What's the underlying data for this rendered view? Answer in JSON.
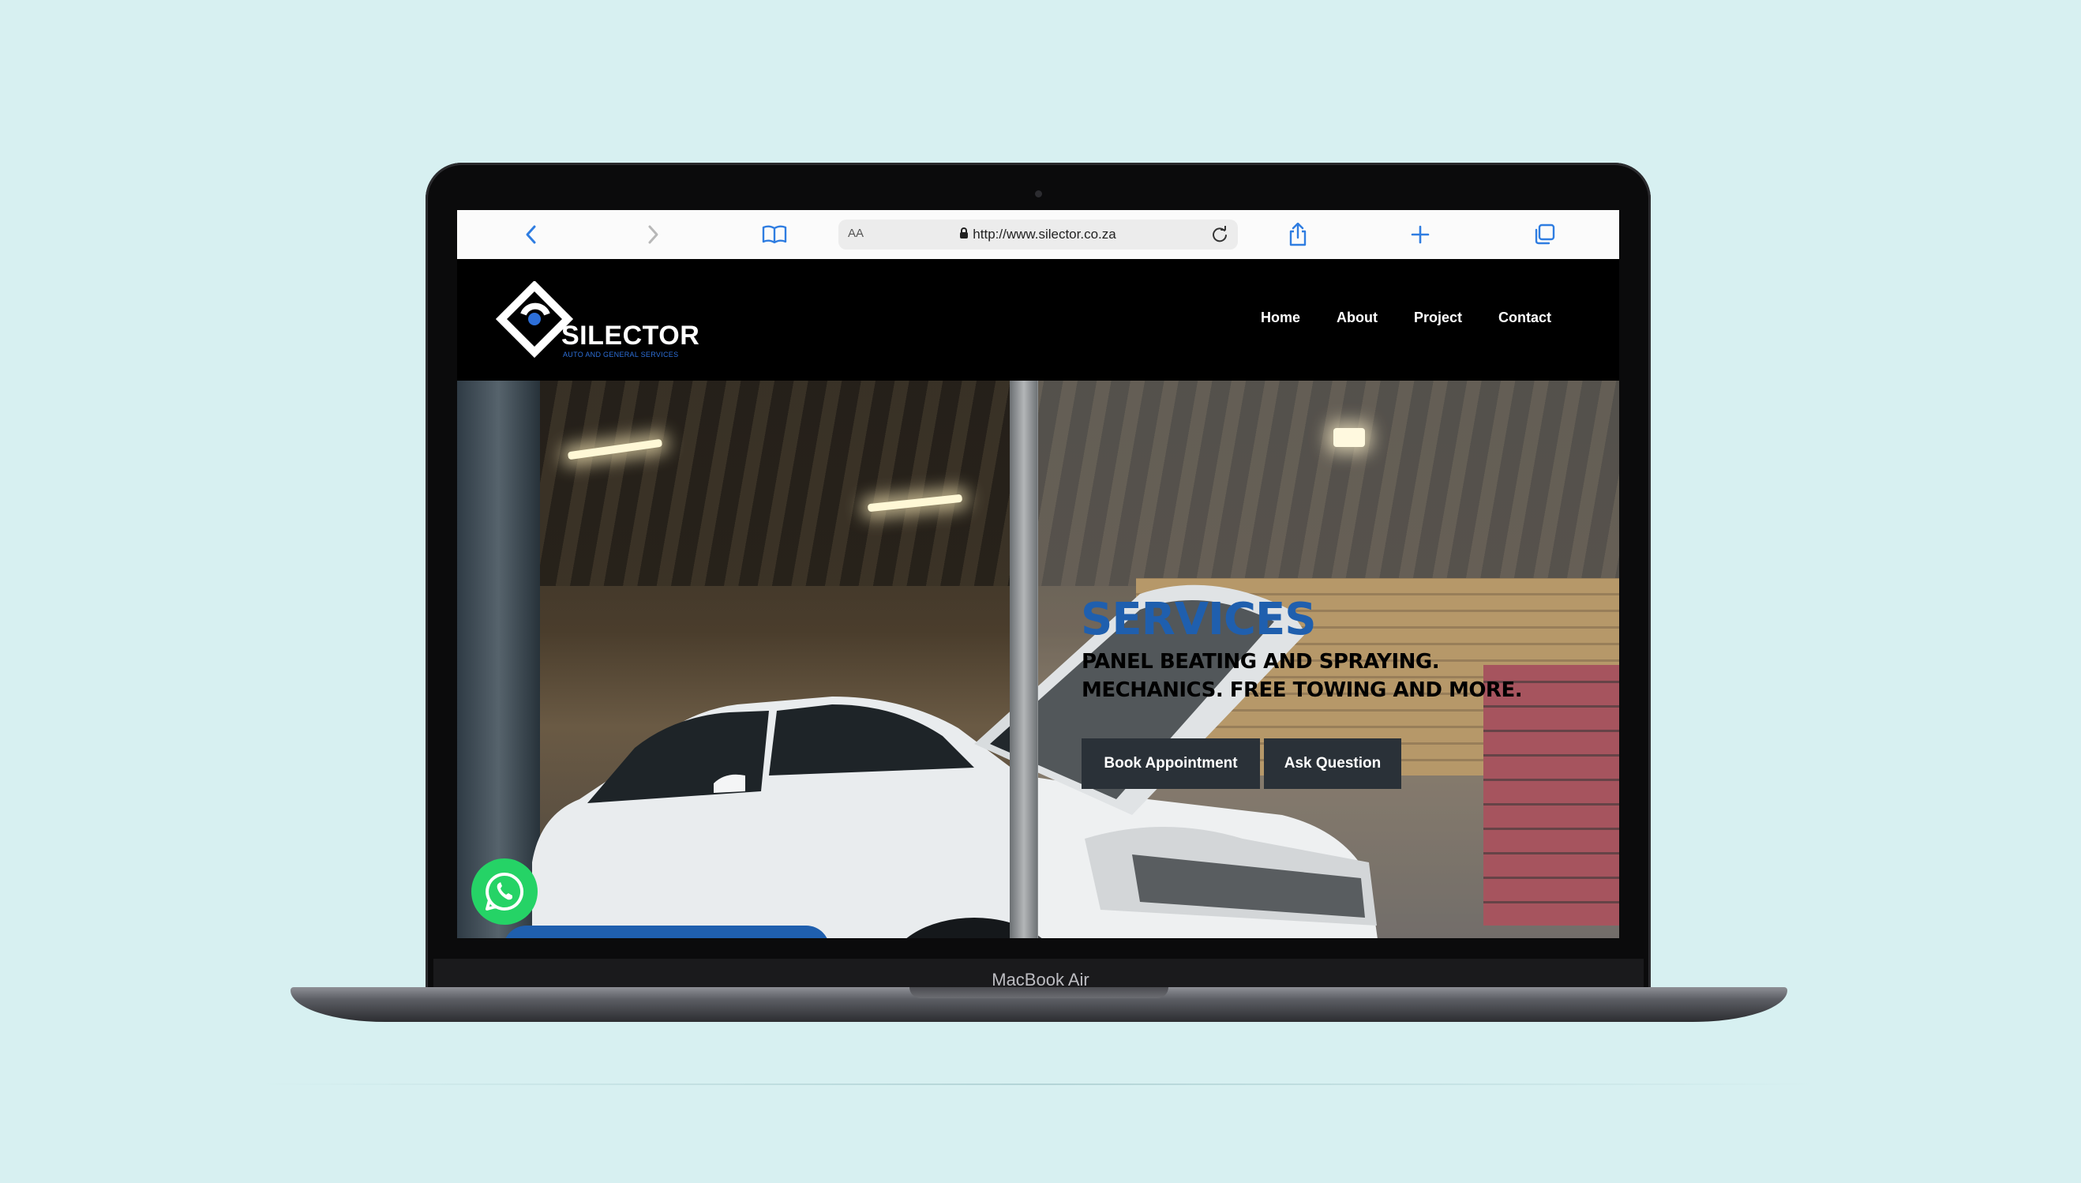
{
  "device": {
    "label": "MacBook Air"
  },
  "browser": {
    "text_size_label": "AA",
    "url": "http://www.silector.co.za",
    "icons": [
      "back-icon",
      "forward-icon",
      "bookmarks-icon",
      "lock-icon",
      "reload-icon",
      "share-icon",
      "new-tab-icon",
      "tabs-icon"
    ]
  },
  "site": {
    "logo": {
      "name": "SILECTOR",
      "tagline": "AUTO AND GENERAL SERVICES"
    },
    "nav": [
      "Home",
      "About",
      "Project",
      "Contact"
    ],
    "hero": {
      "title": "SERVICES",
      "subtitle_line1": "PANEL BEATING AND SPRAYING.",
      "subtitle_line2": "MECHANICS. FREE TOWING AND MORE.",
      "book_button": "Book Appointment",
      "ask_button": "Ask Question"
    },
    "colors": {
      "brand_blue": "#1f5fae",
      "button_bg": "#2a3138",
      "whatsapp_green": "#25d366",
      "background": "#d7f0f1"
    }
  }
}
